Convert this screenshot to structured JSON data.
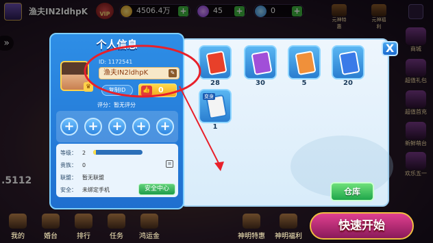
{
  "top_bar": {
    "username": "渔夫IN2ldhpK",
    "vip_label": "VIP",
    "gold": "4506.4万",
    "diamonds": "45",
    "tickets": "0",
    "right_items": [
      "元神特惠",
      "元神福利"
    ]
  },
  "side_right": [
    "商城",
    "超值礼包",
    "超值首充",
    "新鲜萌台",
    "欢乐五一"
  ],
  "left_number": ".5112",
  "bottom_bar": {
    "items": [
      "我的",
      "婚台",
      "排行",
      "任务",
      "鸿运金",
      "神明特惠",
      "神明福利"
    ],
    "quick_start": "快速开始"
  },
  "profile_panel": {
    "title": "个人信息",
    "id_text": "ID: 1172541",
    "name": "渔夫IN2ldhpK",
    "copy_label": "复制ID",
    "likes": "0",
    "rating_label": "评分：暂无评分",
    "level_label": "等级：",
    "level_value": "2",
    "level_progress": 0.05,
    "vip_label": "贵族：",
    "vip_value": "0",
    "union_label": "联盟：",
    "union_value": "暂无联盟",
    "security_label": "安全：",
    "security_value": "未绑定手机",
    "security_button": "安全中心"
  },
  "storage_panel": {
    "items": [
      {
        "count": "28",
        "color": "#e8402a"
      },
      {
        "count": "30",
        "color": "#a14fd8"
      },
      {
        "count": "5",
        "color": "#f0903a"
      },
      {
        "count": "20",
        "color": "#3a7ae8"
      },
      {
        "count": "1",
        "color": "#f4f4f4",
        "tag": "变身"
      }
    ],
    "warehouse_button": "仓库",
    "close": "X"
  },
  "colors": {
    "panel_blue": "#2e8ee6",
    "annotation_red": "#e8202a",
    "accent_green": "#1fa64a"
  }
}
